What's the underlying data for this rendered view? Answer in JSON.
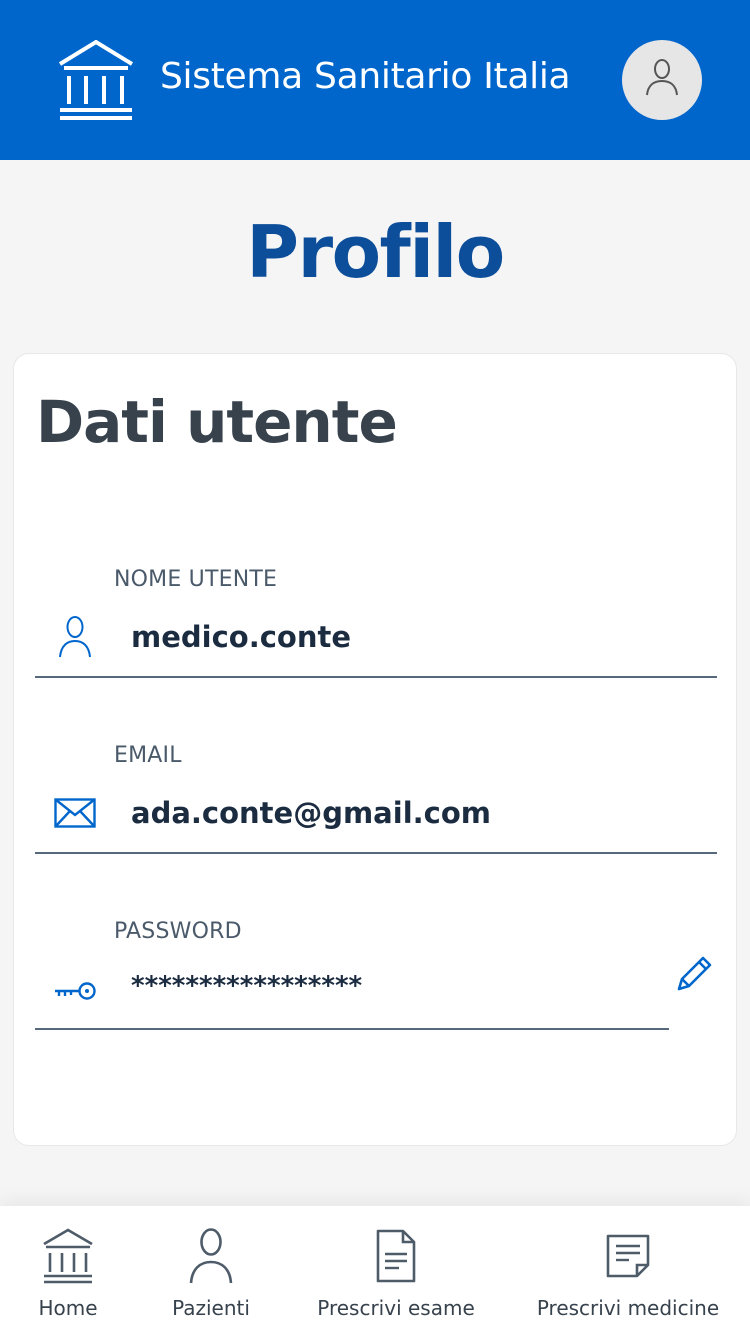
{
  "header": {
    "app_title": "Sistema Sanitario Italia",
    "logo_icon": "institution-icon",
    "avatar_icon": "user-icon"
  },
  "page": {
    "title": "Profilo"
  },
  "card": {
    "title": "Dati utente",
    "fields": [
      {
        "label": "NOME UTENTE",
        "value": "medico.conte",
        "icon": "user-icon"
      },
      {
        "label": "EMAIL",
        "value": "ada.conte@gmail.com",
        "icon": "mail-icon"
      },
      {
        "label": "PASSWORD",
        "value": "*****************",
        "icon": "key-icon"
      }
    ],
    "edit_icon": "pencil-icon"
  },
  "bottom_nav": {
    "items": [
      {
        "label": "Home",
        "icon": "institution-icon"
      },
      {
        "label": "Pazienti",
        "icon": "user-icon"
      },
      {
        "label": "Prescrivi esame",
        "icon": "document-icon"
      },
      {
        "label": "Prescrivi medicine",
        "icon": "note-icon"
      }
    ]
  },
  "colors": {
    "header_bg": "#0066cc",
    "title_blue": "#0d4e9b",
    "icon_blue": "#0066cc",
    "text_dark": "#37424d"
  }
}
